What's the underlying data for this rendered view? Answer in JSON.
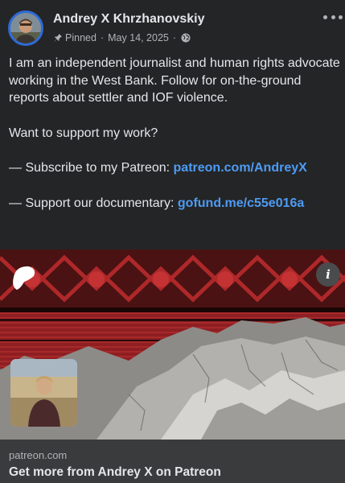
{
  "post": {
    "author": "Andrey X Khrzhanovskiy",
    "pinned_label": "Pinned",
    "separator": "·",
    "date": "May 14, 2025",
    "body_intro": "I am an independent journalist and human rights advocate working in the West Bank. Follow for on-the-ground reports about settler and IOF violence.",
    "support_question": "Want to support my work?",
    "patreon_line_prefix": "— Subscribe to my Patreon: ",
    "patreon_link": "patreon.com/AndreyX",
    "documentary_line_prefix": "— Support our documentary: ",
    "documentary_link": "gofund.me/c55e016a"
  },
  "link_preview": {
    "info_icon_text": "i",
    "domain": "patreon.com",
    "title": "Get more from Andrey X on Patreon"
  },
  "icons": {
    "pin": "pin-icon",
    "globe": "globe-icon",
    "more": "more-options-icon",
    "info": "info-icon",
    "patreon_logo": "patreon-logo-icon"
  },
  "colors": {
    "background": "#242526",
    "text": "#e4e6eb",
    "secondary_text": "#b0b3b8",
    "link": "#4d9bf5",
    "avatar_ring": "#2d6bd8",
    "footer_background": "#3a3b3c",
    "keffiyeh_red": "#b42a2c"
  }
}
